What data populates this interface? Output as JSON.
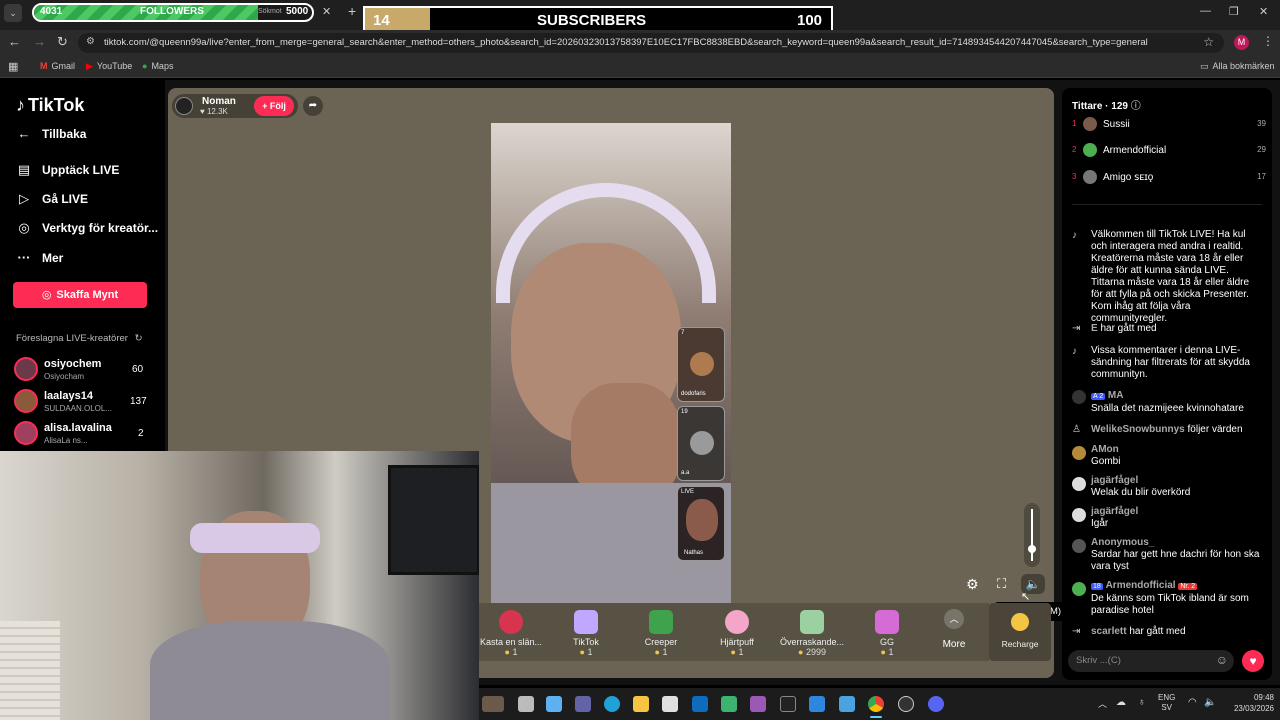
{
  "overlays": {
    "followers": {
      "count": "4031",
      "label": "FOLLOWERS",
      "goal": "5000",
      "progress": 0.806
    },
    "subscribers": {
      "count": "14",
      "label": "SUBSCRIBERS",
      "goal": "100",
      "progress": 0.14
    }
  },
  "browser": {
    "tab_search_hint": "Sökmot",
    "url": "tiktok.com/@queenn99a/live?enter_from_merge=general_search&enter_method=others_photo&search_id=20260323013758397E10EC17FBC8838EBD&search_keyword=queen99a&search_result_id=7148934544207447045&search_type=general",
    "profile_initial": "M",
    "bookmarks": [
      "Gmail",
      "YouTube",
      "Maps"
    ],
    "all_bookmarks": "Alla bokmärken"
  },
  "sidebar": {
    "logo": "TikTok",
    "back": "Tillbaka",
    "items": [
      {
        "label": "Upptäck LIVE",
        "icon": "calendar-icon"
      },
      {
        "label": "Gå LIVE",
        "icon": "camera-icon"
      },
      {
        "label": "Verktyg för kreatör...",
        "icon": "tools-icon"
      },
      {
        "label": "Mer",
        "icon": "more-icon"
      }
    ],
    "coins_button": "Skaffa Mynt",
    "suggested_title": "Föreslagna LIVE-kreatörer",
    "suggested": [
      {
        "name": "osiyochem",
        "sub": "Osiyocham",
        "count": "60"
      },
      {
        "name": "laalays14",
        "sub": "SULDAAN.OLOL...",
        "count": "137"
      },
      {
        "name": "alisa.lavalina",
        "sub": "AlisaLa ns...",
        "count": "2"
      }
    ]
  },
  "stream": {
    "host_name": "Noman",
    "host_likes": "12.3K",
    "follow_label": "+ Följ",
    "guests": [
      {
        "label": "dodofaris",
        "badge": "7"
      },
      {
        "label": "a.a",
        "badge": "19"
      },
      {
        "label": "Nathas",
        "badge": "LIVE"
      }
    ],
    "tooltip": "Inaktivera (M)",
    "gifts": [
      {
        "name": "Kasta en slän...",
        "price": "1"
      },
      {
        "name": "TikTok",
        "price": "1"
      },
      {
        "name": "Creeper",
        "price": "1"
      },
      {
        "name": "Hjärtpuff",
        "price": "1"
      },
      {
        "name": "Överraskande...",
        "price": "2999"
      },
      {
        "name": "GG",
        "price": "1"
      }
    ],
    "more_label": "More",
    "recharge_label": "Recharge"
  },
  "chat": {
    "viewers_label": "Tittare · 129",
    "top_viewers": [
      {
        "rank": "1",
        "name": "Sussii",
        "score": "39"
      },
      {
        "rank": "2",
        "name": "Armendofficial",
        "score": "29"
      },
      {
        "rank": "3",
        "name": "Amigo ꜱᴇɪǫ",
        "score": "17"
      }
    ],
    "messages": [
      {
        "name": "",
        "text": "Välkommen till TikTok LIVE! Ha kul och interagera med andra i realtid. Kreatörerna måste vara 18 år eller äldre för att kunna sända LIVE. Tittarna måste vara 18 år eller äldre för att fylla på och skicka Presenter. Kom ihåg att följa våra communityregler."
      },
      {
        "name": "E",
        "text": "har gått med"
      },
      {
        "name": "",
        "text": "Vissa kommentarer i denna LIVE-sändning har filtrerats för att skydda communityn."
      },
      {
        "name": "MA",
        "text": "Snälla det nazmijeee kvinnohatare"
      },
      {
        "name": "WelikeSnowbunnys",
        "text": "följer värden"
      },
      {
        "name": "AMon",
        "text": "Gombi"
      },
      {
        "name": "jagärfågel",
        "text": "Welak du blir överkörd"
      },
      {
        "name": "jagärfågel",
        "text": "Igår"
      },
      {
        "name": "Anonymous_",
        "text": "Sardar har gett hne dachri för hon ska vara tyst"
      },
      {
        "name": "Armendofficial",
        "text": "De känns som TikTok ibland är som paradise hotel"
      },
      {
        "name": "scarlett",
        "text": "har gått med"
      }
    ],
    "input_placeholder": "Skriv ...(C)"
  },
  "taskbar": {
    "lang_1": "ENG",
    "lang_2": "SV",
    "time": "09:48",
    "date": "23/03/2026"
  }
}
